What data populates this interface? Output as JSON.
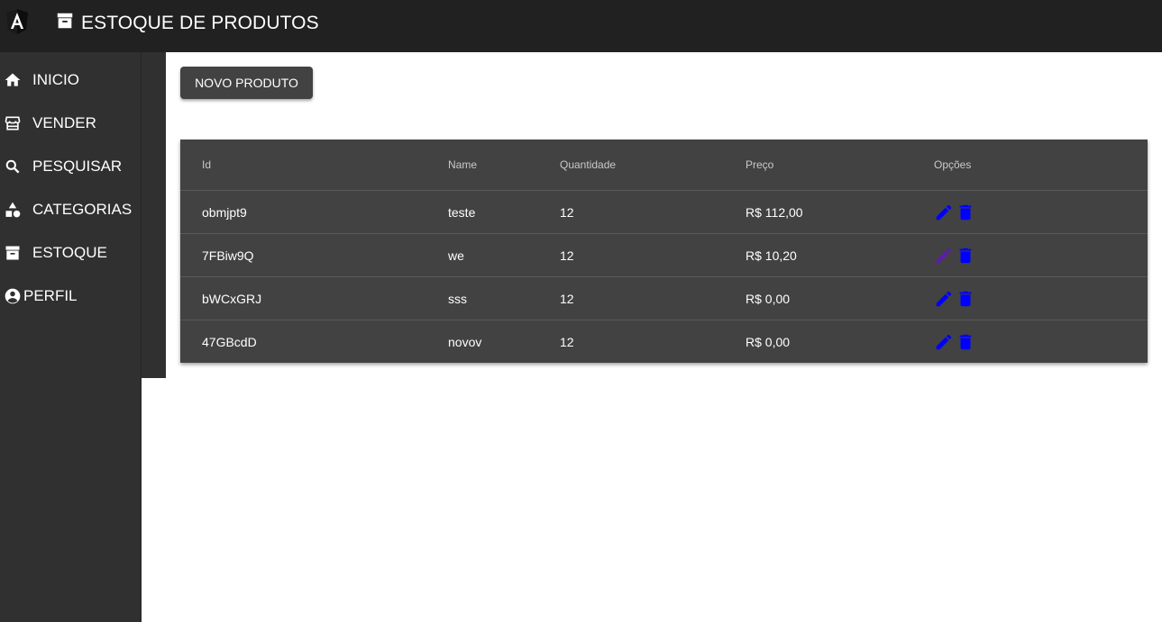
{
  "app": {
    "title": "ESTOQUE DE PRODUTOS"
  },
  "colors": {
    "topbar": "#212121",
    "sidebar": "#303030",
    "table": "#424242",
    "action_icon": "#0000ff",
    "action_icon_muted": "#5b1fa6"
  },
  "sidebar": {
    "items": [
      {
        "label": "INICIO",
        "icon": "home-icon"
      },
      {
        "label": "VENDER",
        "icon": "store-icon"
      },
      {
        "label": "PESQUISAR",
        "icon": "search-icon"
      },
      {
        "label": "CATEGORIAS",
        "icon": "category-icon"
      },
      {
        "label": "ESTOQUE",
        "icon": "archive-icon"
      },
      {
        "label": "PERFIL",
        "icon": "account-circle-icon"
      }
    ]
  },
  "toolbar": {
    "new_product_label": "NOVO PRODUTO"
  },
  "table": {
    "headers": {
      "id": "Id",
      "name": "Name",
      "qty": "Quantidade",
      "price": "Preço",
      "options": "Opções"
    },
    "rows": [
      {
        "id": "obmjpt9",
        "name": "teste",
        "qty": "12",
        "price": "R$ 112,00"
      },
      {
        "id": "7FBiw9Q",
        "name": "we",
        "qty": "12",
        "price": "R$ 10,20"
      },
      {
        "id": "bWCxGRJ",
        "name": "sss",
        "qty": "12",
        "price": "R$ 0,00"
      },
      {
        "id": "47GBcdD",
        "name": "novov",
        "qty": "12",
        "price": "R$ 0,00"
      }
    ]
  }
}
